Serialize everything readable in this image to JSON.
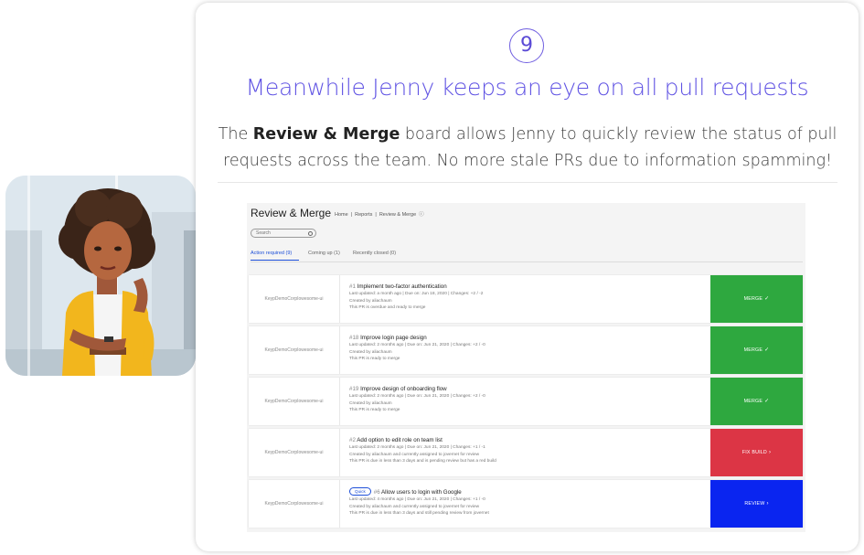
{
  "step_number": "9",
  "headline": "Meanwhile Jenny keeps an eye on all pull requests",
  "description": {
    "pre": "The ",
    "bold": "Review & Merge",
    "post": " board allows Jenny to quickly review the status of pull requests across the team. No more stale PRs due to information spamming!"
  },
  "app": {
    "title": "Review & Merge",
    "breadcrumbs": [
      "Home",
      "|",
      "Reports",
      "|",
      "Review & Merge"
    ],
    "search_placeholder": "Search",
    "tabs": [
      {
        "label": "Action required (9)",
        "active": true
      },
      {
        "label": "Coming up (1)",
        "active": false
      },
      {
        "label": "Recently closed (0)",
        "active": false
      }
    ],
    "pull_requests": [
      {
        "repo": "KeypDemoCorpIowesome-ui",
        "number": "#1",
        "title": "Implement two-factor authentication",
        "quick": "",
        "updated": "Last updated: a month ago  |  Due on: Jun 18, 2020  |  Changes: +2 / -2",
        "created": "Created by aliachaum",
        "status": "This PR is overdue and ready to merge",
        "action": "MERGE",
        "action_glyph": "✓",
        "action_color": "#2ea83f"
      },
      {
        "repo": "KeypDemoCorpIowesome-ui",
        "number": "#18",
        "title": "Improve login page design",
        "quick": "",
        "updated": "Last updated: 2 months ago  |  Due on: Jun 21, 2020  |  Changes: +2 / -0",
        "created": "Created by aliachaum",
        "status": "This PR is ready to merge",
        "action": "MERGE",
        "action_glyph": "✓",
        "action_color": "#2ea83f"
      },
      {
        "repo": "KeypDemoCorpIowesome-ui",
        "number": "#19",
        "title": "Improve design of onboarding flow",
        "quick": "",
        "updated": "Last updated: 2 months ago  |  Due on: Jun 21, 2020  |  Changes: +2 / -0",
        "created": "Created by aliachaum",
        "status": "This PR is ready to merge",
        "action": "MERGE",
        "action_glyph": "✓",
        "action_color": "#2ea83f"
      },
      {
        "repo": "KeypDemoCorpIowesome-ui",
        "number": "#2",
        "title": "Add option to edit role on team list",
        "quick": "",
        "updated": "Last updated: 2 months ago  |  Due on: Jun 21, 2020  |  Changes: +1 / -1",
        "created": "Created by aliachaum and currently assigned to jovernet for review",
        "status": "This PR is due in less than 3 days and is pending review but has a red build",
        "action": "FIX BUILD",
        "action_glyph": "›",
        "action_color": "#dc3545"
      },
      {
        "repo": "KeypDemoCorpIowesome-ui",
        "number": "#6",
        "title": "Allow users to login with Google",
        "quick": "Quick",
        "updated": "Last updated: 4 months ago  |  Due on: Jun 21, 2020  |  Changes: +1 / -0",
        "created": "Created by aliachaum and currently assigned to jovernet for review",
        "status": "This PR is due in less than 3 days and still pending review from jovernet",
        "action": "REVIEW",
        "action_glyph": "›",
        "action_color": "#0a25f0"
      }
    ]
  }
}
